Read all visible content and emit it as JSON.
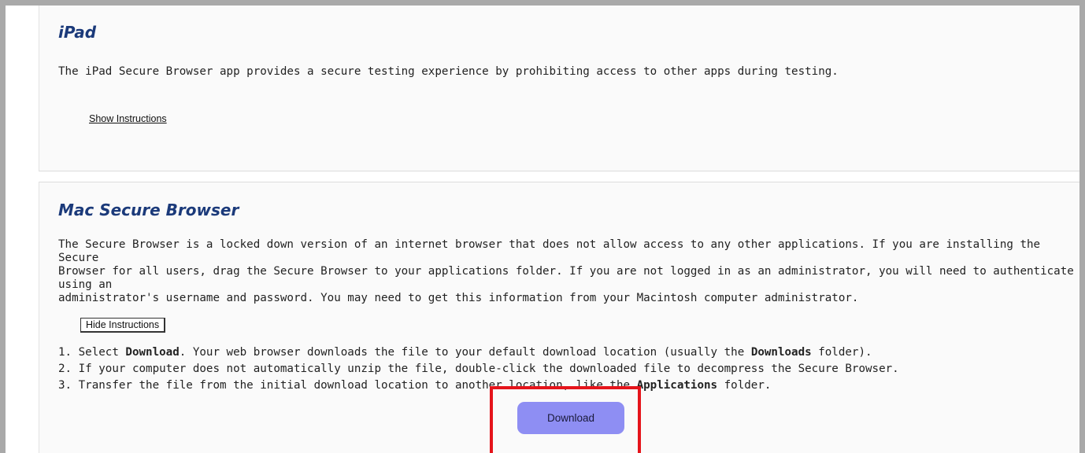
{
  "ipad": {
    "title": "iPad",
    "description": "The iPad Secure Browser app provides a secure testing experience by prohibiting access to other apps during testing.",
    "show_instructions_label": "Show Instructions"
  },
  "mac": {
    "title": "Mac Secure Browser",
    "description_lines": [
      "The Secure Browser is a locked down version of an internet browser that does not allow access to any other applications. If you are installing the Secure",
      "Browser for all users, drag the Secure Browser to your applications folder. If you are not logged in as an administrator, you will need to authenticate using an",
      "administrator's username and password. You may need to get this information from your Macintosh computer administrator."
    ],
    "hide_instructions_label": "Hide Instructions",
    "steps": [
      {
        "pre": "1. Select ",
        "bold1": "Download",
        "mid": ". Your web browser downloads the file to your default download location (usually the ",
        "bold2": "Downloads",
        "post": " folder)."
      },
      {
        "pre": "2. If your computer does not automatically unzip the file, double-click the downloaded file to decompress the Secure Browser.",
        "bold1": "",
        "mid": "",
        "bold2": "",
        "post": ""
      },
      {
        "pre": "3. Transfer the file from the initial download location to another location, like the ",
        "bold1": "Applications",
        "mid": " folder.",
        "bold2": "",
        "post": ""
      }
    ],
    "download_label": "Download"
  },
  "colors": {
    "heading": "#1b3a7a",
    "download_button": "#8e8ef3",
    "highlight_box": "#e5141b"
  }
}
